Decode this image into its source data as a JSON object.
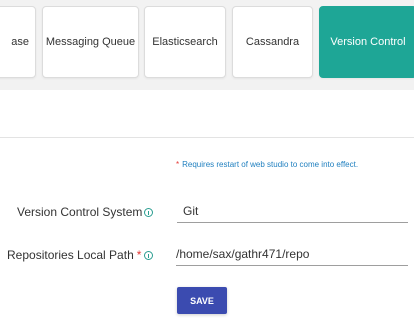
{
  "tabs": [
    {
      "label": "ase",
      "active": false
    },
    {
      "label": "Messaging Queue",
      "active": false
    },
    {
      "label": "Elasticsearch",
      "active": false
    },
    {
      "label": "Cassandra",
      "active": false
    },
    {
      "label": "Version Control",
      "active": true
    }
  ],
  "notice": {
    "marker": "*",
    "text": "Requires restart of web studio to come into effect."
  },
  "form": {
    "version_control_system": {
      "label": "Version Control System",
      "value": "Git",
      "info_icon": "info-icon"
    },
    "repositories_local_path": {
      "label": "Repositories Local Path",
      "required_marker": "*",
      "value": "/home/sax/gathr471/repo",
      "info_icon": "info-icon"
    },
    "save_label": "SAVE"
  },
  "colors": {
    "active_tab": "#1ea696",
    "save_button": "#3b4bb0",
    "notice_text": "#1f7fbf",
    "required": "#e53935"
  }
}
